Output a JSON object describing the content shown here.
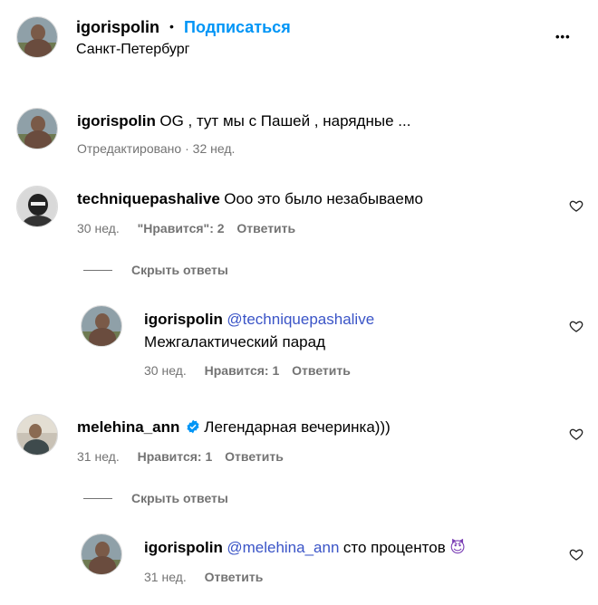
{
  "header": {
    "username": "igorispolin",
    "dot": "•",
    "follow_label": "Подписаться",
    "location": "Санкт-Петербург",
    "more_glyph": "•••"
  },
  "caption": {
    "username": "igorispolin",
    "text": "OG , тут мы с Пашей , нарядные ...",
    "edited": "Отредактировано",
    "sep": "·",
    "time": "32 нед."
  },
  "comments": [
    {
      "username": "techniquepashalive",
      "text": "Ооо это было незабываемо",
      "time": "30 нед.",
      "likes": "\"Нравится\": 2",
      "reply": "Ответить",
      "hide_replies": "Скрыть ответы",
      "replies": [
        {
          "username": "igorispolin",
          "mention": "@techniquepashalive",
          "text": "Межгалактический парад",
          "time": "30 нед.",
          "likes": "Нравится: 1",
          "reply": "Ответить"
        }
      ]
    },
    {
      "username": "melehina_ann",
      "verified": true,
      "text": "Легендарная вечеринка)))",
      "time": "31 нед.",
      "likes": "Нравится: 1",
      "reply": "Ответить",
      "hide_replies": "Скрыть ответы",
      "replies": [
        {
          "username": "igorispolin",
          "mention": "@melehina_ann",
          "text": "сто процентов",
          "emoji": "😈",
          "time": "31 нед.",
          "reply": "Ответить"
        }
      ]
    }
  ],
  "colors": {
    "follow": "#0095f6",
    "mention": "#3a54c7",
    "verified": "#0095f6",
    "meta": "#737373"
  },
  "icons": [
    "avatar",
    "verified-badge-icon",
    "heart-icon",
    "more-options-icon",
    "devil-emoji-icon"
  ]
}
